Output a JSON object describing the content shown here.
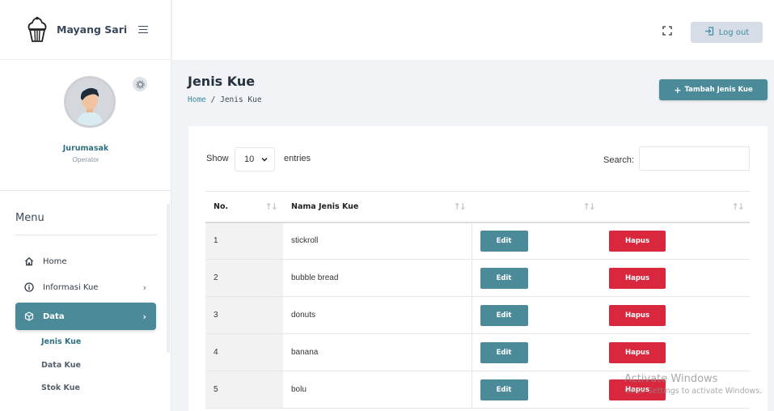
{
  "brand": {
    "name": "Mayang Sari"
  },
  "profile": {
    "name": "Jurumasak",
    "role": "Operator"
  },
  "menu": {
    "title": "Menu",
    "items": [
      {
        "label": "Home",
        "icon": "home-icon"
      },
      {
        "label": "Informasi Kue",
        "icon": "info-icon",
        "chevron": "›"
      },
      {
        "label": "Data",
        "icon": "box-icon",
        "chevron": "›",
        "active": true
      }
    ],
    "submenu": [
      {
        "label": "Jenis Kue",
        "current": true
      },
      {
        "label": "Data Kue"
      },
      {
        "label": "Stok Kue"
      }
    ]
  },
  "topbar": {
    "logout_label": "Log out"
  },
  "page": {
    "title": "Jenis Kue",
    "breadcrumb": {
      "home": "Home",
      "separator": "/",
      "current": "Jenis Kue"
    },
    "add_button": "Tambah Jenis Kue"
  },
  "table_controls": {
    "show_label": "Show",
    "entries_value": "10",
    "entries_label": "entries",
    "search_label": "Search:",
    "search_value": ""
  },
  "table": {
    "headers": [
      "No.",
      "Nama Jenis Kue",
      "",
      ""
    ],
    "rows": [
      {
        "no": "1",
        "name": "stickroll",
        "edit": "Edit",
        "delete": "Hapus"
      },
      {
        "no": "2",
        "name": "bubble bread",
        "edit": "Edit",
        "delete": "Hapus"
      },
      {
        "no": "3",
        "name": "donuts",
        "edit": "Edit",
        "delete": "Hapus"
      },
      {
        "no": "4",
        "name": "banana",
        "edit": "Edit",
        "delete": "Hapus"
      },
      {
        "no": "5",
        "name": "bolu",
        "edit": "Edit",
        "delete": "Hapus"
      }
    ]
  },
  "watermark": {
    "title": "Activate Windows",
    "subtitle": "Go to Settings to activate Windows."
  },
  "colors": {
    "accent": "#4b8a98",
    "danger": "#d9283d",
    "link": "#3d8ba0"
  }
}
